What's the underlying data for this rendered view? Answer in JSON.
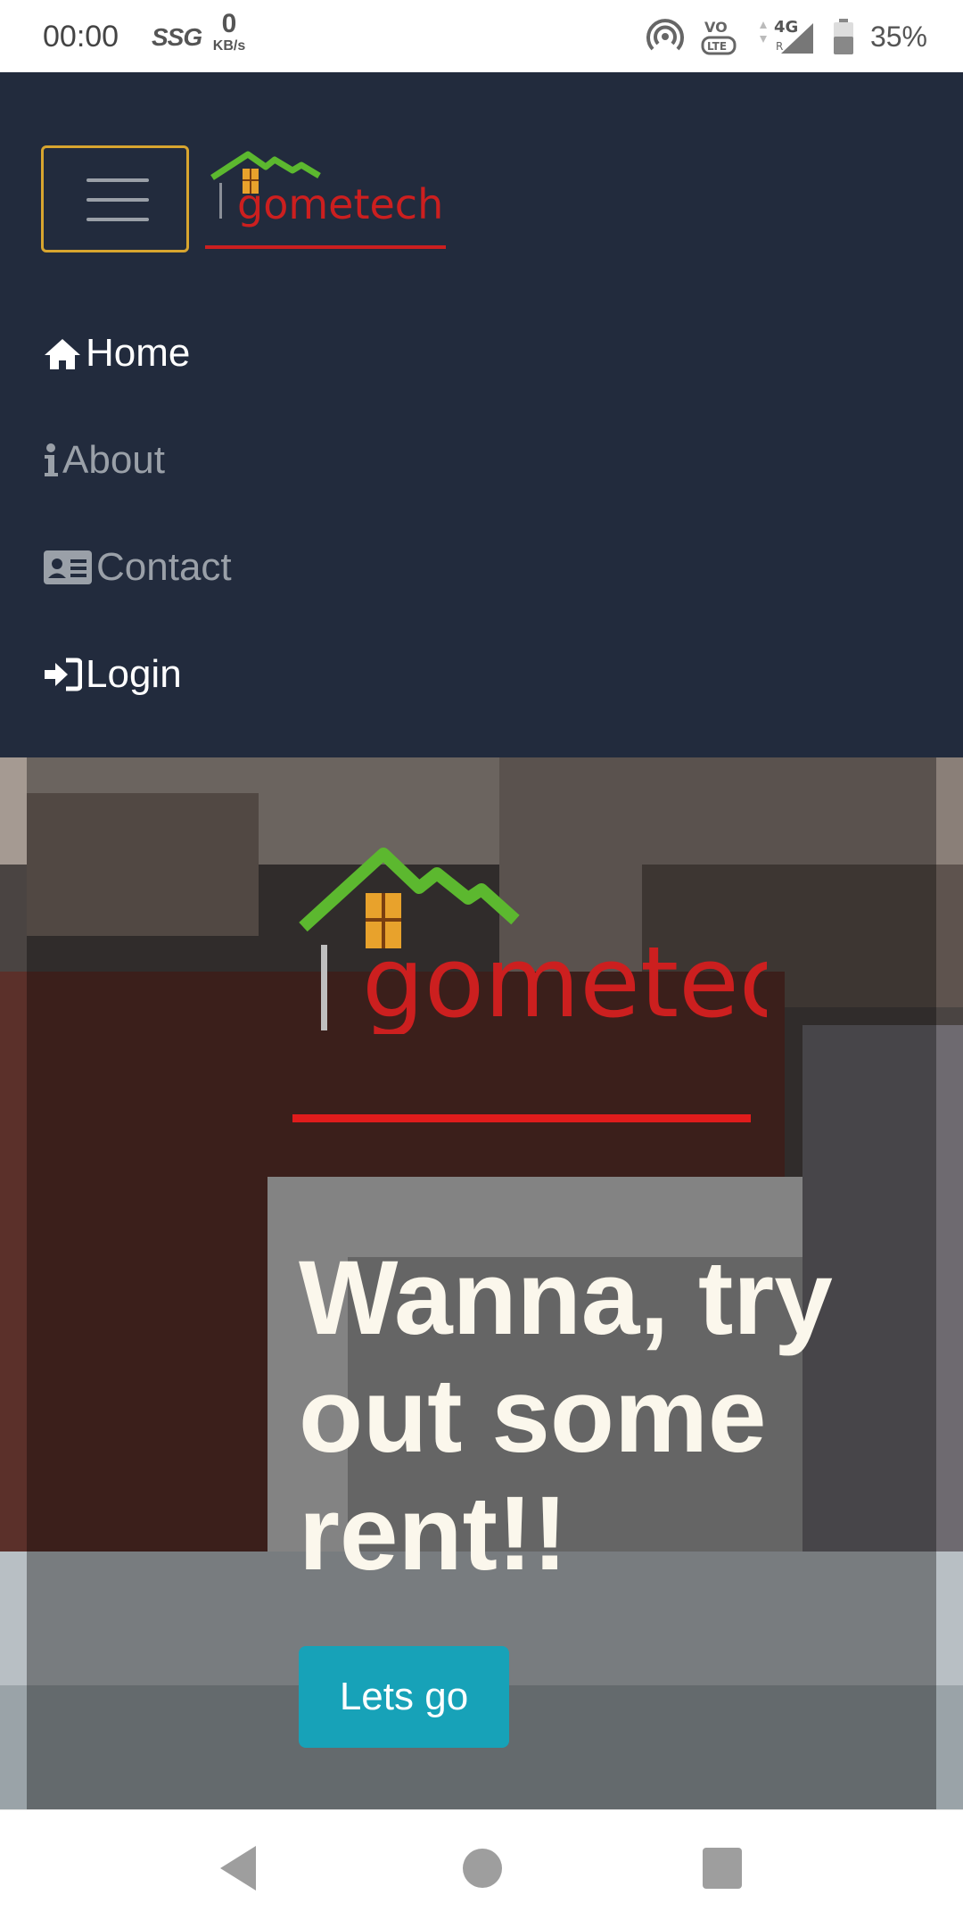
{
  "status_bar": {
    "time": "00:00",
    "carrier": "SSG",
    "speed_value": "0",
    "speed_unit": "KB/s",
    "network": "4G",
    "battery": "35%"
  },
  "navbar": {
    "brand": "gometech",
    "links": [
      {
        "label": "Home",
        "icon": "home-icon",
        "active": true
      },
      {
        "label": "About",
        "icon": "info-icon",
        "active": false
      },
      {
        "label": "Contact",
        "icon": "address-card-icon",
        "active": false
      },
      {
        "label": "Login",
        "icon": "sign-in-icon",
        "active": true
      }
    ]
  },
  "hero": {
    "brand": "gometech",
    "heading": "Wanna, try out some rent!!",
    "button": "Lets go"
  },
  "colors": {
    "navbar_bg": "#222b3d",
    "toggler_border": "#d8a52f",
    "cta_bg": "#17a2b8",
    "logo_red": "#cc1f1f",
    "logo_green": "#5cb82f"
  }
}
